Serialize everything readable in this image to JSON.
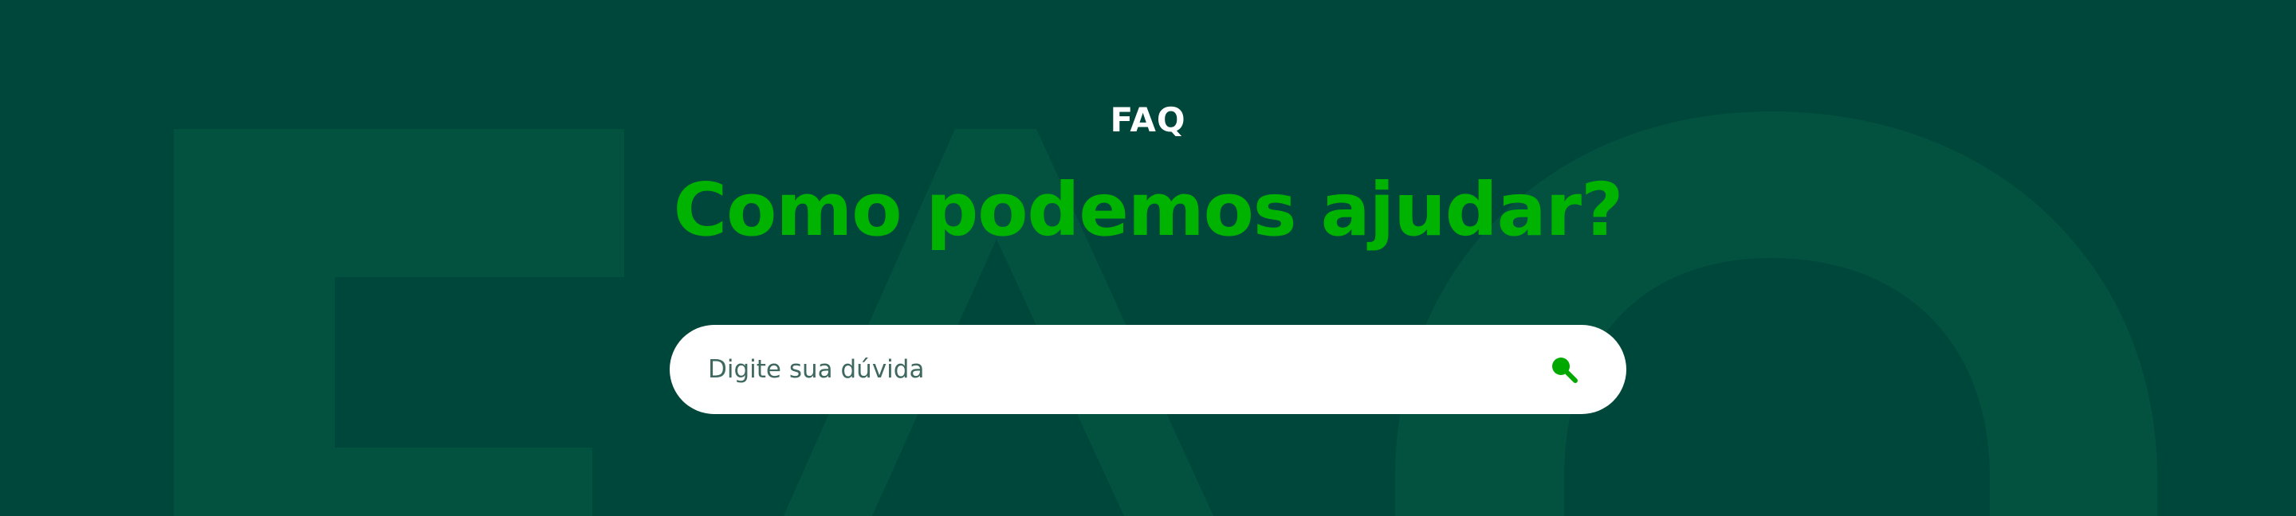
{
  "hero": {
    "eyebrow": "FAQ",
    "title": "Como podemos ajudar?",
    "background_letters": "FAQ"
  },
  "search": {
    "placeholder": "Digite sua dúvida",
    "value": "",
    "icon": "search-icon"
  },
  "colors": {
    "background": "#00473b",
    "background_letters": "#03523f",
    "accent": "#00b300",
    "eyebrow_text": "#ffffff",
    "search_bg": "#ffffff",
    "placeholder_text": "#3f6860"
  }
}
